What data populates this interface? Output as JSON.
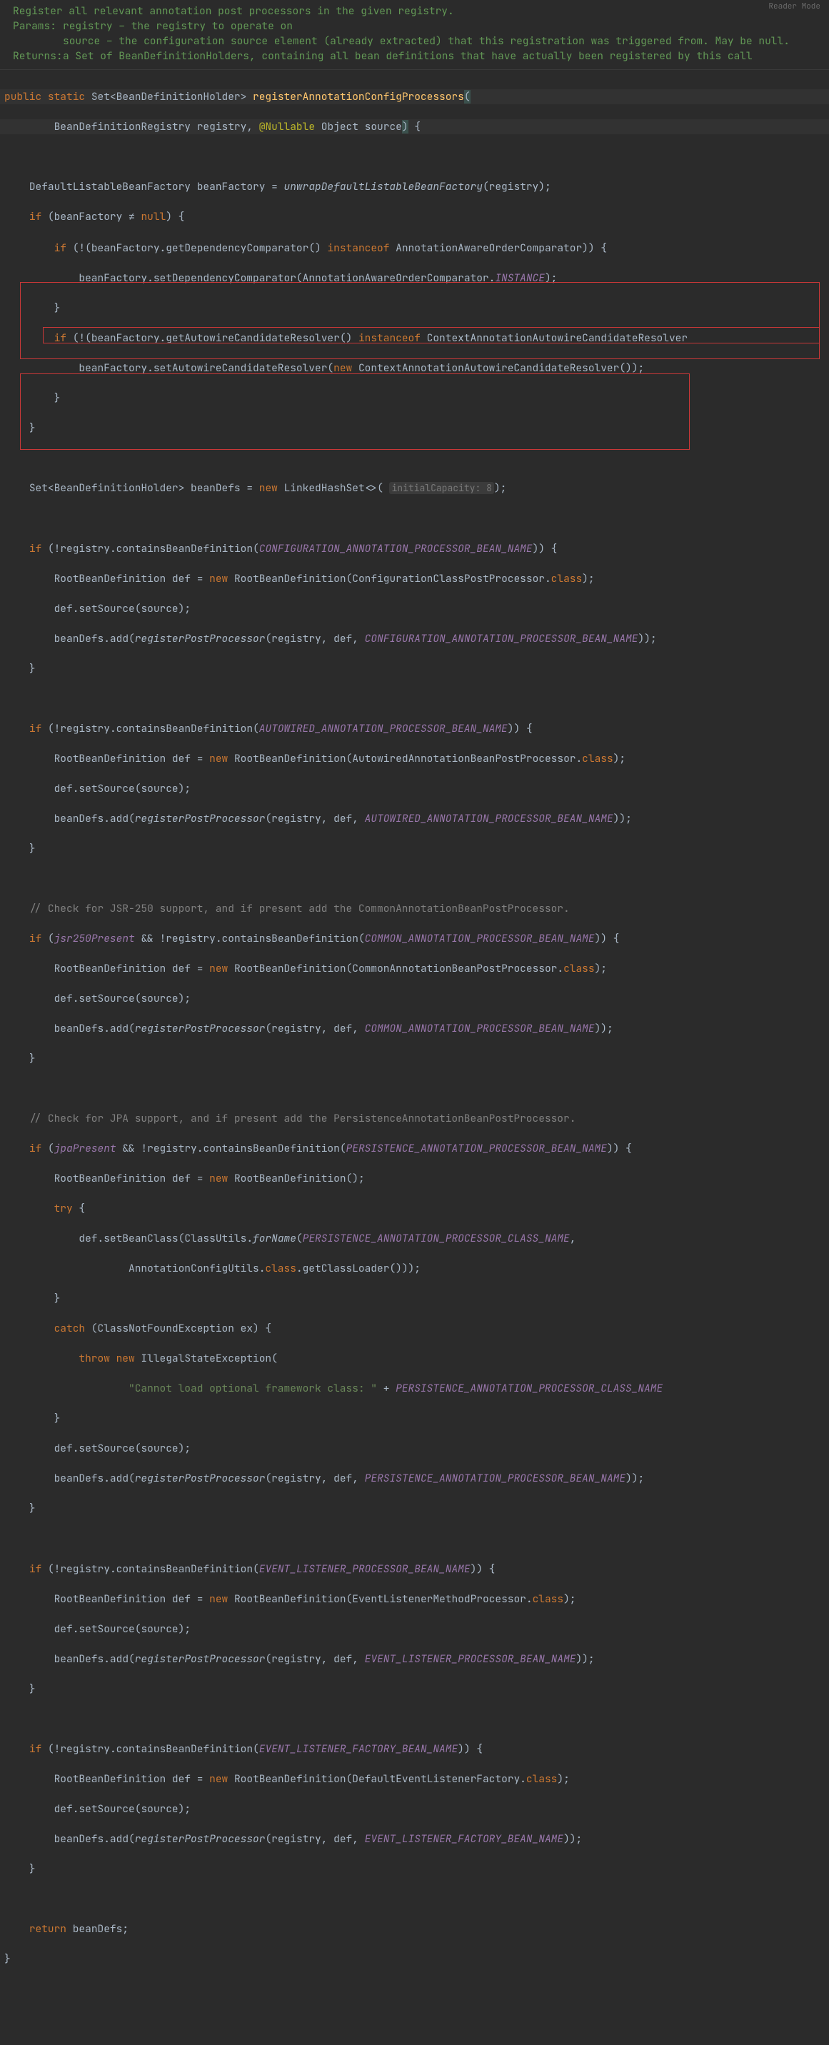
{
  "readerMode": "Reader Mode",
  "doc": {
    "summary": "Register all relevant annotation post processors in the given registry.",
    "paramsLabel": "Params:",
    "param1": "registry – the registry to operate on",
    "param2": "source – the configuration source element (already extracted) that this registration was triggered from. May be null.",
    "returnsLabel": "Returns:",
    "returnsText": "a Set of BeanDefinitionHolders, containing all bean definitions that have actually been registered by this call"
  },
  "code": {
    "kw_public": "public",
    "kw_static": "static",
    "kw_if": "if",
    "kw_new": "new",
    "kw_null": "null",
    "kw_instanceof": "instanceof",
    "kw_try": "try",
    "kw_catch": "catch",
    "kw_throw": "throw",
    "kw_return": "return",
    "kw_class": "class",
    "neq": "≠",
    "annotation_nullable": "@Nullable",
    "t_Set": "Set",
    "t_BeanDefinitionHolder": "BeanDefinitionHolder",
    "t_BeanDefinitionRegistry": "BeanDefinitionRegistry",
    "t_Object": "Object",
    "t_DefaultListableBeanFactory": "DefaultListableBeanFactory",
    "t_AnnotationAwareOrderComparator": "AnnotationAwareOrderComparator",
    "t_ContextAnnotationAutowireCandidateResolver": "ContextAnnotationAutowireCandidateResolver",
    "t_LinkedHashSet": "LinkedHashSet",
    "t_RootBeanDefinition": "RootBeanDefinition",
    "t_ConfigurationClassPostProcessor": "ConfigurationClassPostProcessor",
    "t_AutowiredAnnotationBeanPostProcessor": "AutowiredAnnotationBeanPostProcessor",
    "t_CommonAnnotationBeanPostProcessor": "CommonAnnotationBeanPostProcessor",
    "t_ClassUtils": "ClassUtils",
    "t_AnnotationConfigUtils": "AnnotationConfigUtils",
    "t_ClassNotFoundException": "ClassNotFoundException",
    "t_IllegalStateException": "IllegalStateException",
    "t_EventListenerMethodProcessor": "EventListenerMethodProcessor",
    "t_DefaultEventListenerFactory": "DefaultEventListenerFactory",
    "m_registerAnnotationConfigProcessors": "registerAnnotationConfigProcessors",
    "m_unwrapDefaultListableBeanFactory": "unwrapDefaultListableBeanFactory",
    "m_registerPostProcessor": "registerPostProcessor",
    "m_forName": "forName",
    "f_INSTANCE": "INSTANCE",
    "f_CONFIGURATION_ANNOTATION_PROCESSOR_BEAN_NAME": "CONFIGURATION_ANNOTATION_PROCESSOR_BEAN_NAME",
    "f_AUTOWIRED_ANNOTATION_PROCESSOR_BEAN_NAME": "AUTOWIRED_ANNOTATION_PROCESSOR_BEAN_NAME",
    "f_COMMON_ANNOTATION_PROCESSOR_BEAN_NAME": "COMMON_ANNOTATION_PROCESSOR_BEAN_NAME",
    "f_PERSISTENCE_ANNOTATION_PROCESSOR_BEAN_NAME": "PERSISTENCE_ANNOTATION_PROCESSOR_BEAN_NAME",
    "f_PERSISTENCE_ANNOTATION_PROCESSOR_CLASS_NAME": "PERSISTENCE_ANNOTATION_PROCESSOR_CLASS_NAME",
    "f_EVENT_LISTENER_PROCESSOR_BEAN_NAME": "EVENT_LISTENER_PROCESSOR_BEAN_NAME",
    "f_EVENT_LISTENER_FACTORY_BEAN_NAME": "EVENT_LISTENER_FACTORY_BEAN_NAME",
    "v_jsr250Present": "jsr250Present",
    "v_jpaPresent": "jpaPresent",
    "p_registry": "registry",
    "p_source": "source",
    "v_beanFactory": "beanFactory",
    "v_beanDefs": "beanDefs",
    "v_def": "def",
    "v_ex": "ex",
    "hint_initialCapacity": "initialCapacity:",
    "hint_8": "8",
    "str_cannot_load": "\"Cannot load optional framework class: \"",
    "comment_jsr250": "// Check for JSR-250 support, and if present add the CommonAnnotationBeanPostProcessor.",
    "comment_jpa": "// Check for JPA support, and if present add the PersistenceAnnotationBeanPostProcessor.",
    "call_getDependencyComparator": "getDependencyComparator",
    "call_setDependencyComparator": "setDependencyComparator",
    "call_getAutowireCandidateResolver": "getAutowireCandidateResolver",
    "call_setAutowireCandidateResolver": "setAutowireCandidateResolver",
    "call_containsBeanDefinition": "containsBeanDefinition",
    "call_setSource": "setSource",
    "call_add": "add",
    "call_setBeanClass": "setBeanClass",
    "call_getClassLoader": "getClassLoader"
  }
}
